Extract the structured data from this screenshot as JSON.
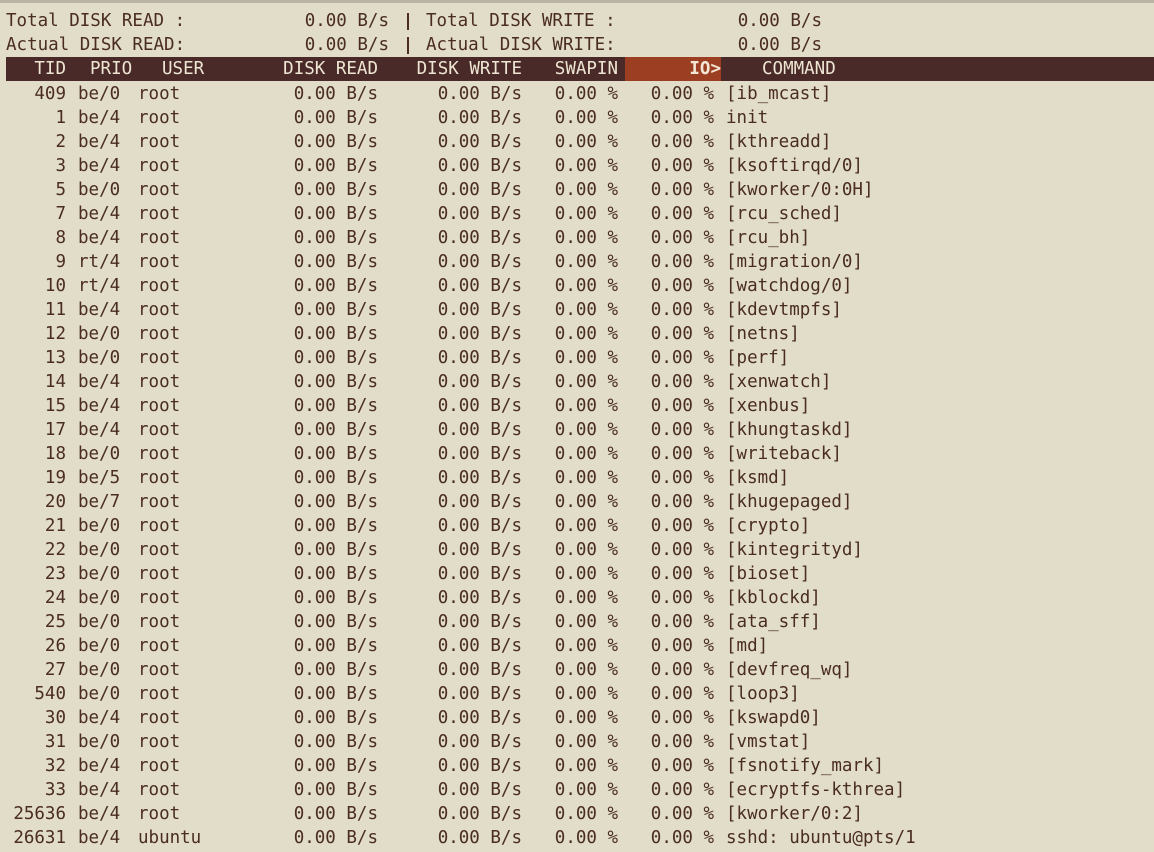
{
  "summary": {
    "total_read_label": "Total DISK READ :",
    "total_read_value": "0.00 B/s",
    "total_write_label": "Total DISK WRITE :",
    "total_write_value": "0.00 B/s",
    "actual_read_label": "Actual DISK READ:",
    "actual_read_value": "0.00 B/s",
    "actual_write_label": "Actual DISK WRITE:",
    "actual_write_value": "0.00 B/s",
    "separator": "|"
  },
  "columns": {
    "tid": "TID",
    "prio": "PRIO",
    "user": "USER",
    "disk_read": "DISK READ",
    "disk_write": "DISK WRITE",
    "swapin": "SWAPIN",
    "io": "IO>",
    "command": "COMMAND"
  },
  "colors": {
    "background": "#e2ddc9",
    "text": "#4a2c22",
    "header_bg": "#4a2a28",
    "sort_column_bg": "#9c3e22"
  },
  "processes": [
    {
      "tid": "409",
      "prio": "be/0",
      "user": "root",
      "read": "0.00 B/s",
      "write": "0.00 B/s",
      "swapin": "0.00 %",
      "io": "0.00 %",
      "command": "[ib_mcast]"
    },
    {
      "tid": "1",
      "prio": "be/4",
      "user": "root",
      "read": "0.00 B/s",
      "write": "0.00 B/s",
      "swapin": "0.00 %",
      "io": "0.00 %",
      "command": "init"
    },
    {
      "tid": "2",
      "prio": "be/4",
      "user": "root",
      "read": "0.00 B/s",
      "write": "0.00 B/s",
      "swapin": "0.00 %",
      "io": "0.00 %",
      "command": "[kthreadd]"
    },
    {
      "tid": "3",
      "prio": "be/4",
      "user": "root",
      "read": "0.00 B/s",
      "write": "0.00 B/s",
      "swapin": "0.00 %",
      "io": "0.00 %",
      "command": "[ksoftirqd/0]"
    },
    {
      "tid": "5",
      "prio": "be/0",
      "user": "root",
      "read": "0.00 B/s",
      "write": "0.00 B/s",
      "swapin": "0.00 %",
      "io": "0.00 %",
      "command": "[kworker/0:0H]"
    },
    {
      "tid": "7",
      "prio": "be/4",
      "user": "root",
      "read": "0.00 B/s",
      "write": "0.00 B/s",
      "swapin": "0.00 %",
      "io": "0.00 %",
      "command": "[rcu_sched]"
    },
    {
      "tid": "8",
      "prio": "be/4",
      "user": "root",
      "read": "0.00 B/s",
      "write": "0.00 B/s",
      "swapin": "0.00 %",
      "io": "0.00 %",
      "command": "[rcu_bh]"
    },
    {
      "tid": "9",
      "prio": "rt/4",
      "user": "root",
      "read": "0.00 B/s",
      "write": "0.00 B/s",
      "swapin": "0.00 %",
      "io": "0.00 %",
      "command": "[migration/0]"
    },
    {
      "tid": "10",
      "prio": "rt/4",
      "user": "root",
      "read": "0.00 B/s",
      "write": "0.00 B/s",
      "swapin": "0.00 %",
      "io": "0.00 %",
      "command": "[watchdog/0]"
    },
    {
      "tid": "11",
      "prio": "be/4",
      "user": "root",
      "read": "0.00 B/s",
      "write": "0.00 B/s",
      "swapin": "0.00 %",
      "io": "0.00 %",
      "command": "[kdevtmpfs]"
    },
    {
      "tid": "12",
      "prio": "be/0",
      "user": "root",
      "read": "0.00 B/s",
      "write": "0.00 B/s",
      "swapin": "0.00 %",
      "io": "0.00 %",
      "command": "[netns]"
    },
    {
      "tid": "13",
      "prio": "be/0",
      "user": "root",
      "read": "0.00 B/s",
      "write": "0.00 B/s",
      "swapin": "0.00 %",
      "io": "0.00 %",
      "command": "[perf]"
    },
    {
      "tid": "14",
      "prio": "be/4",
      "user": "root",
      "read": "0.00 B/s",
      "write": "0.00 B/s",
      "swapin": "0.00 %",
      "io": "0.00 %",
      "command": "[xenwatch]"
    },
    {
      "tid": "15",
      "prio": "be/4",
      "user": "root",
      "read": "0.00 B/s",
      "write": "0.00 B/s",
      "swapin": "0.00 %",
      "io": "0.00 %",
      "command": "[xenbus]"
    },
    {
      "tid": "17",
      "prio": "be/4",
      "user": "root",
      "read": "0.00 B/s",
      "write": "0.00 B/s",
      "swapin": "0.00 %",
      "io": "0.00 %",
      "command": "[khungtaskd]"
    },
    {
      "tid": "18",
      "prio": "be/0",
      "user": "root",
      "read": "0.00 B/s",
      "write": "0.00 B/s",
      "swapin": "0.00 %",
      "io": "0.00 %",
      "command": "[writeback]"
    },
    {
      "tid": "19",
      "prio": "be/5",
      "user": "root",
      "read": "0.00 B/s",
      "write": "0.00 B/s",
      "swapin": "0.00 %",
      "io": "0.00 %",
      "command": "[ksmd]"
    },
    {
      "tid": "20",
      "prio": "be/7",
      "user": "root",
      "read": "0.00 B/s",
      "write": "0.00 B/s",
      "swapin": "0.00 %",
      "io": "0.00 %",
      "command": "[khugepaged]"
    },
    {
      "tid": "21",
      "prio": "be/0",
      "user": "root",
      "read": "0.00 B/s",
      "write": "0.00 B/s",
      "swapin": "0.00 %",
      "io": "0.00 %",
      "command": "[crypto]"
    },
    {
      "tid": "22",
      "prio": "be/0",
      "user": "root",
      "read": "0.00 B/s",
      "write": "0.00 B/s",
      "swapin": "0.00 %",
      "io": "0.00 %",
      "command": "[kintegrityd]"
    },
    {
      "tid": "23",
      "prio": "be/0",
      "user": "root",
      "read": "0.00 B/s",
      "write": "0.00 B/s",
      "swapin": "0.00 %",
      "io": "0.00 %",
      "command": "[bioset]"
    },
    {
      "tid": "24",
      "prio": "be/0",
      "user": "root",
      "read": "0.00 B/s",
      "write": "0.00 B/s",
      "swapin": "0.00 %",
      "io": "0.00 %",
      "command": "[kblockd]"
    },
    {
      "tid": "25",
      "prio": "be/0",
      "user": "root",
      "read": "0.00 B/s",
      "write": "0.00 B/s",
      "swapin": "0.00 %",
      "io": "0.00 %",
      "command": "[ata_sff]"
    },
    {
      "tid": "26",
      "prio": "be/0",
      "user": "root",
      "read": "0.00 B/s",
      "write": "0.00 B/s",
      "swapin": "0.00 %",
      "io": "0.00 %",
      "command": "[md]"
    },
    {
      "tid": "27",
      "prio": "be/0",
      "user": "root",
      "read": "0.00 B/s",
      "write": "0.00 B/s",
      "swapin": "0.00 %",
      "io": "0.00 %",
      "command": "[devfreq_wq]"
    },
    {
      "tid": "540",
      "prio": "be/0",
      "user": "root",
      "read": "0.00 B/s",
      "write": "0.00 B/s",
      "swapin": "0.00 %",
      "io": "0.00 %",
      "command": "[loop3]"
    },
    {
      "tid": "30",
      "prio": "be/4",
      "user": "root",
      "read": "0.00 B/s",
      "write": "0.00 B/s",
      "swapin": "0.00 %",
      "io": "0.00 %",
      "command": "[kswapd0]"
    },
    {
      "tid": "31",
      "prio": "be/0",
      "user": "root",
      "read": "0.00 B/s",
      "write": "0.00 B/s",
      "swapin": "0.00 %",
      "io": "0.00 %",
      "command": "[vmstat]"
    },
    {
      "tid": "32",
      "prio": "be/4",
      "user": "root",
      "read": "0.00 B/s",
      "write": "0.00 B/s",
      "swapin": "0.00 %",
      "io": "0.00 %",
      "command": "[fsnotify_mark]"
    },
    {
      "tid": "33",
      "prio": "be/4",
      "user": "root",
      "read": "0.00 B/s",
      "write": "0.00 B/s",
      "swapin": "0.00 %",
      "io": "0.00 %",
      "command": "[ecryptfs-kthrea]"
    },
    {
      "tid": "25636",
      "prio": "be/4",
      "user": "root",
      "read": "0.00 B/s",
      "write": "0.00 B/s",
      "swapin": "0.00 %",
      "io": "0.00 %",
      "command": "[kworker/0:2]"
    },
    {
      "tid": "26631",
      "prio": "be/4",
      "user": "ubuntu",
      "read": "0.00 B/s",
      "write": "0.00 B/s",
      "swapin": "0.00 %",
      "io": "0.00 %",
      "command": "sshd: ubuntu@pts/1"
    }
  ]
}
